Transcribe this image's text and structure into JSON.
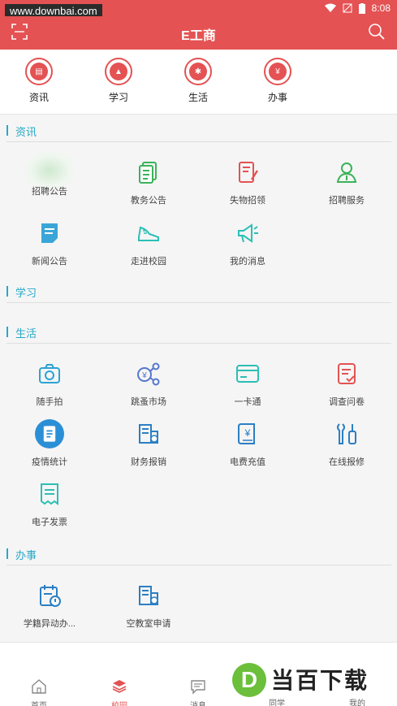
{
  "status": {
    "watermark": "www.downbai.com",
    "time": "8:08"
  },
  "appbar": {
    "title": "E工商"
  },
  "quicknav": [
    {
      "label": "资讯",
      "icon": "news-icon"
    },
    {
      "label": "学习",
      "icon": "graduation-cap-icon"
    },
    {
      "label": "生活",
      "icon": "palm-tree-icon"
    },
    {
      "label": "办事",
      "icon": "money-bag-icon"
    }
  ],
  "sections": {
    "zixun": {
      "title": "资讯",
      "items": [
        {
          "label": "招聘公告",
          "icon": "blurred-icon"
        },
        {
          "label": "教务公告",
          "icon": "documents-icon"
        },
        {
          "label": "失物招领",
          "icon": "book-pen-icon"
        },
        {
          "label": "招聘服务",
          "icon": "person-icon"
        },
        {
          "label": "新闻公告",
          "icon": "note-icon"
        },
        {
          "label": "走进校园",
          "icon": "sneaker-icon"
        },
        {
          "label": "我的消息",
          "icon": "megaphone-icon"
        }
      ]
    },
    "xuexi": {
      "title": "学习"
    },
    "shenghuo": {
      "title": "生活",
      "items": [
        {
          "label": "随手拍",
          "icon": "camera-icon"
        },
        {
          "label": "跳蚤市场",
          "icon": "market-icon"
        },
        {
          "label": "一卡通",
          "icon": "card-icon"
        },
        {
          "label": "调查问卷",
          "icon": "survey-icon"
        },
        {
          "label": "疫情统计",
          "icon": "stats-icon"
        },
        {
          "label": "财务报销",
          "icon": "building-icon"
        },
        {
          "label": "电费充值",
          "icon": "bill-icon"
        },
        {
          "label": "在线报修",
          "icon": "wrench-icon"
        },
        {
          "label": "电子发票",
          "icon": "receipt-icon"
        }
      ]
    },
    "banshi": {
      "title": "办事",
      "items": [
        {
          "label": "学籍异动办...",
          "icon": "calendar-alert-icon"
        },
        {
          "label": "空教室申请",
          "icon": "building-icon"
        }
      ]
    }
  },
  "tabs": [
    {
      "label": "首页"
    },
    {
      "label": "校园"
    },
    {
      "label": "消息"
    },
    {
      "label": "同学"
    },
    {
      "label": "我的"
    }
  ],
  "overlay_logo": {
    "letter": "D",
    "text": "当百下载"
  },
  "colors": {
    "brand": "#e45253",
    "accent": "#26a9c9",
    "green": "#3bb35a"
  }
}
